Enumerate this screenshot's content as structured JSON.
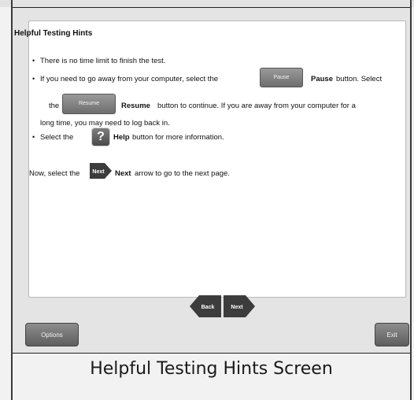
{
  "content": {
    "title": "Helpful Testing Hints",
    "hint1": "There is no time limit to finish the test.",
    "hint2_pre": "If you need to go away from your computer, select the",
    "pause_label": "Pause",
    "hint2_bold": "Pause",
    "hint2_post": "button. Select",
    "hint2_line2_pre": "the",
    "resume_label": "Resume",
    "hint2_line2_bold": "Resume",
    "hint2_line2_post": "button to continue. If you are away from your computer for a",
    "hint2_line3": "long time, you may need to log back in.",
    "hint3_pre": "Select the",
    "help_symbol": "?",
    "hint3_bold": "Help",
    "hint3_post": "button for more information.",
    "next_pre": "Now, select the",
    "next_icon_label": "Next",
    "next_bold": "Next",
    "next_post": "arrow to go to the next page."
  },
  "navigation": {
    "back_label": "Back",
    "next_label": "Next"
  },
  "footer": {
    "options_label": "Options",
    "exit_label": "Exit"
  },
  "caption": "Helpful Testing Hints Screen",
  "icons": [
    "help-icon",
    "next-arrow-icon",
    "back-arrow-icon"
  ],
  "colors": {
    "button_gray": "#6e6e6e",
    "arrow_dark": "#3c3c3c",
    "panel_bg": "#e4e4e4"
  }
}
